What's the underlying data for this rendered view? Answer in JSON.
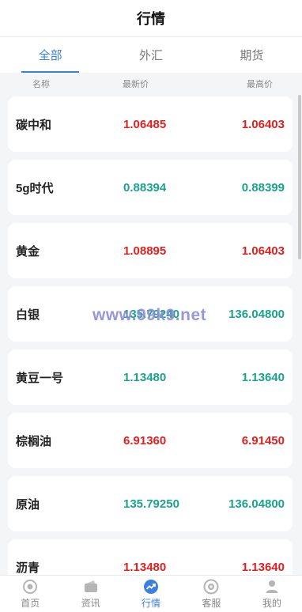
{
  "header": {
    "title": "行情"
  },
  "tabs": [
    {
      "label": "全部",
      "active": true
    },
    {
      "label": "外汇",
      "active": false
    },
    {
      "label": "期货",
      "active": false
    }
  ],
  "columns": {
    "name": "名称",
    "latest": "最新价",
    "high": "最高价"
  },
  "rows": [
    {
      "name": "碳中和",
      "latest": "1.06485",
      "high": "1.06403",
      "latest_dir": "up",
      "high_dir": "up"
    },
    {
      "name": "5g时代",
      "latest": "0.88394",
      "high": "0.88399",
      "latest_dir": "down",
      "high_dir": "down"
    },
    {
      "name": "黄金",
      "latest": "1.08895",
      "high": "1.06403",
      "latest_dir": "up",
      "high_dir": "up"
    },
    {
      "name": "白银",
      "latest": "135.79240",
      "high": "136.04800",
      "latest_dir": "down",
      "high_dir": "down"
    },
    {
      "name": "黄豆一号",
      "latest": "1.13480",
      "high": "1.13640",
      "latest_dir": "down",
      "high_dir": "down"
    },
    {
      "name": "棕榈油",
      "latest": "6.91360",
      "high": "6.91450",
      "latest_dir": "up",
      "high_dir": "up"
    },
    {
      "name": "原油",
      "latest": "135.79250",
      "high": "136.04800",
      "latest_dir": "down",
      "high_dir": "down"
    },
    {
      "name": "沥青",
      "latest": "1.13480",
      "high": "1.13640",
      "latest_dir": "up",
      "high_dir": "up"
    }
  ],
  "watermark": "www.99k9.net",
  "colors": {
    "accent": "#3b7fe0",
    "up": "#e02020",
    "down": "#1aa38a"
  },
  "tabbar": [
    {
      "label": "首页",
      "icon": "home-icon",
      "active": false
    },
    {
      "label": "资讯",
      "icon": "wallet-icon",
      "active": false
    },
    {
      "label": "行情",
      "icon": "trend-icon",
      "active": true
    },
    {
      "label": "客服",
      "icon": "support-icon",
      "active": false
    },
    {
      "label": "我的",
      "icon": "user-icon",
      "active": false
    }
  ]
}
